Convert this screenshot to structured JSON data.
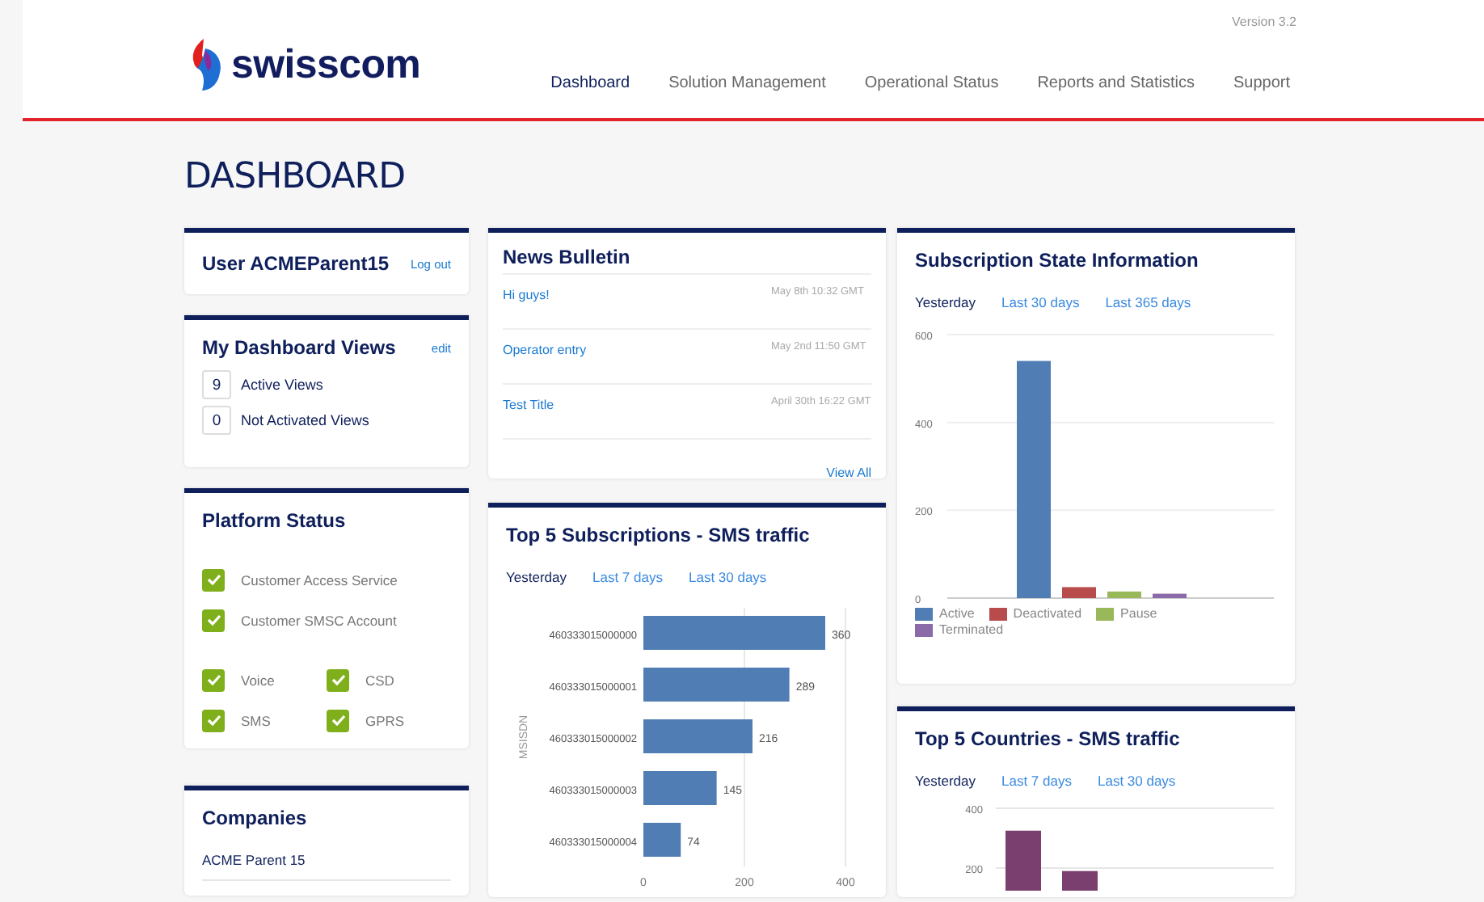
{
  "header": {
    "version": "Version 3.2",
    "logo": "swisscom",
    "nav": [
      {
        "label": "Dashboard",
        "selected": true
      },
      {
        "label": "Solution Management",
        "selected": false
      },
      {
        "label": "Operational Status",
        "selected": false
      },
      {
        "label": "Reports and Statistics",
        "selected": false
      },
      {
        "label": "Support",
        "selected": false
      }
    ]
  },
  "page_title": "DASHBOARD",
  "user_card": {
    "title": "User ACMEParent15",
    "link": "Log out"
  },
  "dashboard_views": {
    "title": "My Dashboard Views",
    "link": "edit",
    "counts": [
      {
        "count": "9",
        "label": "Active Views"
      },
      {
        "count": "0",
        "label": "Not Activated Views"
      }
    ]
  },
  "platform_status": {
    "title": "Platform Status",
    "services": [
      {
        "label": "Customer Access Service",
        "checked": true
      },
      {
        "label": "Customer SMSC Account",
        "checked": true
      }
    ],
    "channels": [
      {
        "label": "Voice",
        "checked": true
      },
      {
        "label": "CSD",
        "checked": true
      },
      {
        "label": "SMS",
        "checked": true
      },
      {
        "label": "GPRS",
        "checked": true
      }
    ]
  },
  "companies": {
    "title": "Companies",
    "items": [
      "ACME Parent 15"
    ]
  },
  "news": {
    "title": "News Bulletin",
    "items": [
      {
        "title": "Hi guys!",
        "date": "May 8th 10:32 GMT"
      },
      {
        "title": "Operator entry",
        "date": "May 2nd 11:50 GMT"
      },
      {
        "title": "Test Title",
        "date": "April 30th 16:22 GMT"
      }
    ],
    "view_all": "View All"
  },
  "top_subscriptions": {
    "title": "Top 5 Subscriptions - SMS traffic",
    "periods": [
      {
        "label": "Yesterday",
        "selected": true
      },
      {
        "label": "Last 7 days",
        "selected": false
      },
      {
        "label": "Last 30 days",
        "selected": false
      }
    ],
    "chart_data": {
      "type": "bar",
      "orientation": "horizontal",
      "ylabel": "MSISDN",
      "categories": [
        "460333015000000",
        "460333015000001",
        "460333015000002",
        "460333015000003",
        "460333015000004"
      ],
      "series": [
        {
          "color": "#4f7db4",
          "values": [
            360,
            289,
            216,
            145,
            74
          ]
        }
      ],
      "xlim": [
        0,
        400
      ],
      "xticks": [
        0,
        200,
        400
      ],
      "data_labels": true
    }
  },
  "subscription_state": {
    "title": "Subscription State Information",
    "periods": [
      {
        "label": "Yesterday",
        "selected": true
      },
      {
        "label": "Last 30 days",
        "selected": false
      },
      {
        "label": "Last 365 days",
        "selected": false
      }
    ],
    "chart_data": {
      "type": "bar",
      "ylim": [
        0,
        600
      ],
      "yticks": [
        0,
        200,
        400,
        600
      ],
      "series": [
        {
          "name": "Active",
          "color": "#4f7db4",
          "values": [
            540
          ]
        },
        {
          "name": "Deactivated",
          "color": "#b84c4c",
          "values": [
            25
          ]
        },
        {
          "name": "Pause",
          "color": "#98b85a",
          "values": [
            15
          ]
        },
        {
          "name": "Terminated",
          "color": "#8a6aa8",
          "values": [
            10
          ]
        }
      ]
    }
  },
  "top_countries": {
    "title": "Top 5 Countries - SMS traffic",
    "periods": [
      {
        "label": "Yesterday",
        "selected": true
      },
      {
        "label": "Last 7 days",
        "selected": false
      },
      {
        "label": "Last 30 days",
        "selected": false
      }
    ],
    "chart_data": {
      "type": "bar",
      "ylim": [
        0,
        400
      ],
      "yticks": [
        200,
        400
      ],
      "series": [
        {
          "color": "#7a3f6e",
          "values": [
            325,
            190
          ]
        }
      ]
    }
  }
}
